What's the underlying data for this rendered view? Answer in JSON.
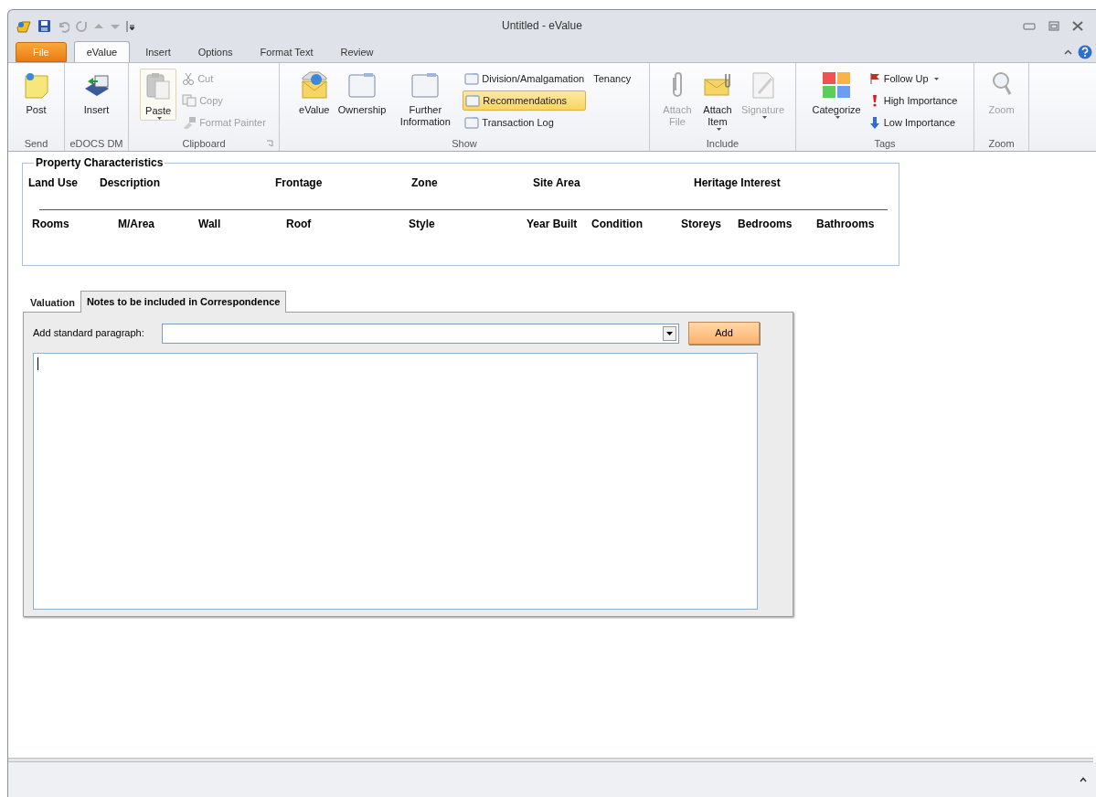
{
  "window": {
    "title": "Untitled - eValue"
  },
  "ribbon_tabs": [
    {
      "label": "File",
      "kind": "file",
      "selected": false
    },
    {
      "label": "eValue",
      "kind": "tab",
      "selected": true
    },
    {
      "label": "Insert",
      "kind": "tab",
      "selected": false
    },
    {
      "label": "Options",
      "kind": "tab",
      "selected": false
    },
    {
      "label": "Format Text",
      "kind": "tab",
      "selected": false
    },
    {
      "label": "Review",
      "kind": "tab",
      "selected": false
    }
  ],
  "ribbon_groups": [
    {
      "label": "Send",
      "launcher": false,
      "items": [
        {
          "label": "Post",
          "kind": "large",
          "disabled": false,
          "dropdown": false
        }
      ]
    },
    {
      "label": "eDOCS DM",
      "launcher": false,
      "items": [
        {
          "label": "Insert",
          "kind": "large",
          "disabled": false,
          "dropdown": false
        }
      ]
    },
    {
      "label": "Clipboard",
      "launcher": true,
      "items": [
        {
          "label": "Paste",
          "kind": "large",
          "disabled": false,
          "dropdown": true
        },
        {
          "label": "Cut",
          "kind": "small",
          "disabled": true,
          "dropdown": false
        },
        {
          "label": "Copy",
          "kind": "small",
          "disabled": true,
          "dropdown": false
        },
        {
          "label": "Format Painter",
          "kind": "small",
          "disabled": true,
          "dropdown": false
        }
      ]
    },
    {
      "label": "Show",
      "launcher": false,
      "items": [
        {
          "label": "eValue",
          "kind": "large",
          "disabled": false,
          "dropdown": false,
          "selected": false
        },
        {
          "label": "Ownership",
          "kind": "large",
          "disabled": false,
          "dropdown": false,
          "selected": false
        },
        {
          "label": "Further Information",
          "kind": "large",
          "disabled": false,
          "dropdown": false,
          "selected": false
        },
        {
          "label": "Division/Amalgamation",
          "kind": "small",
          "disabled": false,
          "dropdown": false,
          "selected": false
        },
        {
          "label": "Recommendations",
          "kind": "small",
          "disabled": false,
          "dropdown": false,
          "selected": true
        },
        {
          "label": "Transaction Log",
          "kind": "small",
          "disabled": false,
          "dropdown": false,
          "selected": false
        },
        {
          "label": "Tenancy",
          "kind": "plain",
          "disabled": false,
          "dropdown": false,
          "selected": false
        }
      ]
    },
    {
      "label": "Include",
      "launcher": false,
      "items": [
        {
          "label": "Attach File",
          "kind": "large",
          "disabled": true,
          "dropdown": false
        },
        {
          "label": "Attach Item",
          "kind": "large",
          "disabled": false,
          "dropdown": true
        },
        {
          "label": "Signature",
          "kind": "large",
          "disabled": true,
          "dropdown": true
        }
      ]
    },
    {
      "label": "Tags",
      "launcher": false,
      "items": [
        {
          "label": "Categorize",
          "kind": "large",
          "disabled": false,
          "dropdown": true
        },
        {
          "label": "Follow Up",
          "kind": "small",
          "disabled": false,
          "dropdown": true
        },
        {
          "label": "High Importance",
          "kind": "small",
          "disabled": false,
          "dropdown": false
        },
        {
          "label": "Low Importance",
          "kind": "small",
          "disabled": false,
          "dropdown": false
        }
      ]
    },
    {
      "label": "Zoom",
      "launcher": false,
      "items": [
        {
          "label": "Zoom",
          "kind": "large",
          "disabled": true,
          "dropdown": false
        }
      ]
    }
  ],
  "property_characteristics": {
    "title": "Property Characteristics",
    "row_1": [
      "Land Use",
      "Description",
      "Frontage",
      "Zone",
      "Site Area",
      "Heritage Interest"
    ],
    "row_2": [
      "Rooms",
      "M/Area",
      "Wall",
      "Roof",
      "Style",
      "Year Built",
      "Condition",
      "Storeys",
      "Bedrooms",
      "Bathrooms"
    ]
  },
  "tabs": [
    {
      "label": "Valuation",
      "selected": false
    },
    {
      "label": "Notes to be included in Correspondence",
      "selected": true
    }
  ],
  "standard_paragraph": {
    "label": "Add standard paragraph:",
    "button": "Add"
  }
}
